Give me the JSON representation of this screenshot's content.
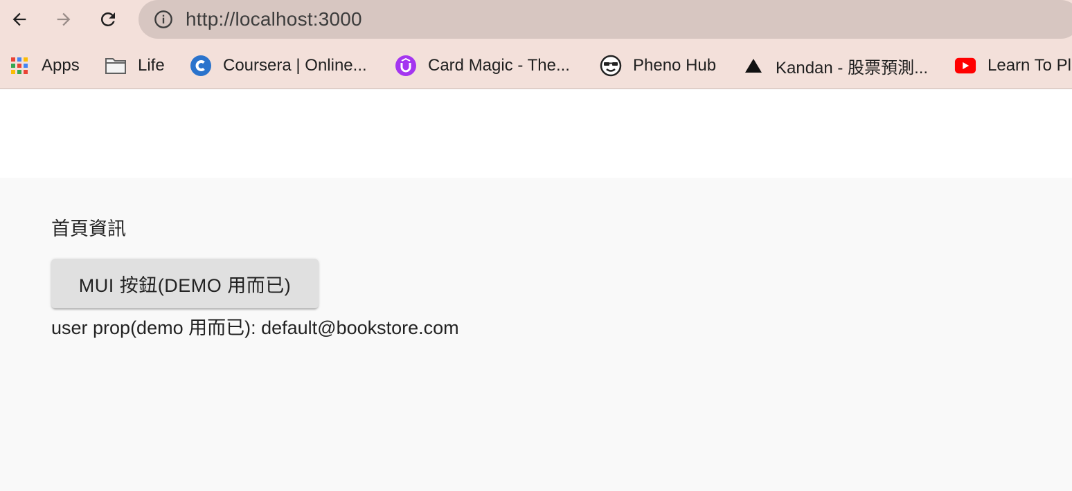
{
  "browser": {
    "url": "http://localhost:3000",
    "bookmarks": [
      {
        "label": "Apps",
        "icon": "apps-grid-icon"
      },
      {
        "label": "Life",
        "icon": "folder-icon"
      },
      {
        "label": "Coursera | Online...",
        "icon": "coursera-icon"
      },
      {
        "label": "Card Magic - The...",
        "icon": "udemy-icon"
      },
      {
        "label": "Pheno Hub",
        "icon": "sunglasses-face-icon"
      },
      {
        "label": "Kandan - 股票預測...",
        "icon": "triangle-icon"
      },
      {
        "label": "Learn To Pl",
        "icon": "youtube-icon"
      }
    ]
  },
  "page": {
    "title": "首頁資訊",
    "button_label": "MUI 按鈕(DEMO 用而已)",
    "user_prop": "user prop(demo 用而已): default@bookstore.com"
  },
  "colors": {
    "chrome_bg": "#f3e0da",
    "address_bg": "#d7c6c1",
    "content_bg": "#f9f9f9",
    "button_bg": "#e0e0e0"
  }
}
